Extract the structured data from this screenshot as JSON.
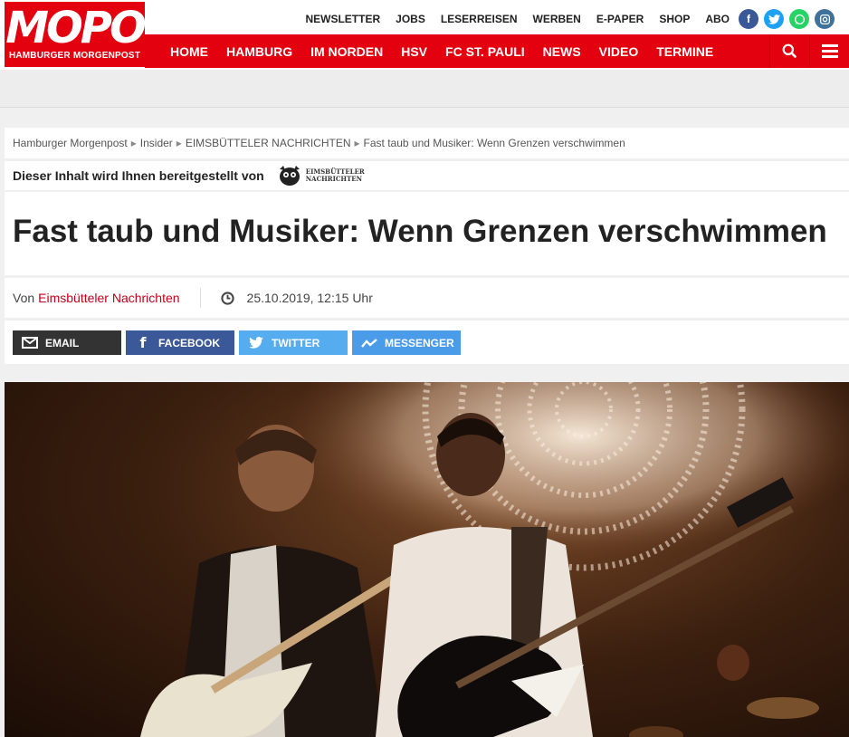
{
  "header": {
    "logo_title": "MOPO",
    "logo_subtitle": "HAMBURGER MORGENPOST",
    "top_links": [
      "NEWSLETTER",
      "JOBS",
      "LESERREISEN",
      "WERBEN",
      "E-PAPER",
      "SHOP",
      "ABO"
    ],
    "social": [
      {
        "name": "facebook-icon",
        "color": "#3b5998",
        "glyph": "f"
      },
      {
        "name": "twitter-icon",
        "color": "#1da1f2",
        "glyph": "t"
      },
      {
        "name": "whatsapp-icon",
        "color": "#25d366",
        "glyph": "w"
      },
      {
        "name": "instagram-icon",
        "color": "#3f729b",
        "glyph": "◎"
      }
    ],
    "main_nav": [
      "HOME",
      "HAMBURG",
      "IM NORDEN",
      "HSV",
      "FC ST. PAULI",
      "NEWS",
      "VIDEO",
      "TERMINE"
    ],
    "brand_color": "#e3000f"
  },
  "breadcrumb": {
    "items": [
      "Hamburger Morgenpost",
      "Insider",
      "EIMSBÜTTELER NACHRICHTEN",
      "Fast taub und Musiker: Wenn Grenzen verschwimmen"
    ]
  },
  "sponsor": {
    "label": "Dieser Inhalt wird Ihnen bereitgestellt von",
    "logo_line1": "EIMSBÜTTELER",
    "logo_line2": "NACHRICHTEN"
  },
  "article": {
    "title": "Fast taub und Musiker: Wenn Grenzen verschwimmen",
    "by_prefix": "Von",
    "author": "Eimsbütteler Nachrichten",
    "date": "25.10.2019, 12:15 Uhr"
  },
  "share": [
    {
      "label": "EMAIL",
      "color": "#333333",
      "icon": "mail-icon"
    },
    {
      "label": "FACEBOOK",
      "color": "#3b5998",
      "icon": "facebook-icon"
    },
    {
      "label": "TWITTER",
      "color": "#55acee",
      "icon": "twitter-icon"
    },
    {
      "label": "MESSENGER",
      "color": "#4a9be8",
      "icon": "messenger-icon"
    }
  ]
}
